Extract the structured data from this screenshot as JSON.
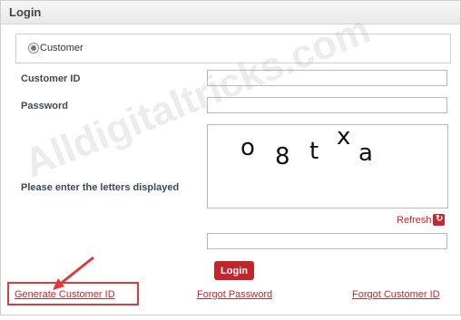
{
  "panel": {
    "title": "Login"
  },
  "radio": {
    "label": "Customer",
    "selected": true
  },
  "form": {
    "customer_id_label": "Customer ID",
    "password_label": "Password",
    "captcha_label": "Please enter the letters displayed",
    "captcha_chars": [
      "o",
      "8",
      "t",
      "x",
      "a"
    ],
    "refresh_label": "Refresh",
    "refresh_icon": "refresh-icon",
    "login_label": "Login"
  },
  "links": {
    "generate_customer_id": "Generate Customer ID",
    "forgot_password": "Forgot Password",
    "forgot_customer_id": "Forgot Customer ID"
  },
  "watermark": "Alldigitaltricks.com",
  "colors": {
    "accent": "#c0262b",
    "highlight": "#e03a3a"
  }
}
